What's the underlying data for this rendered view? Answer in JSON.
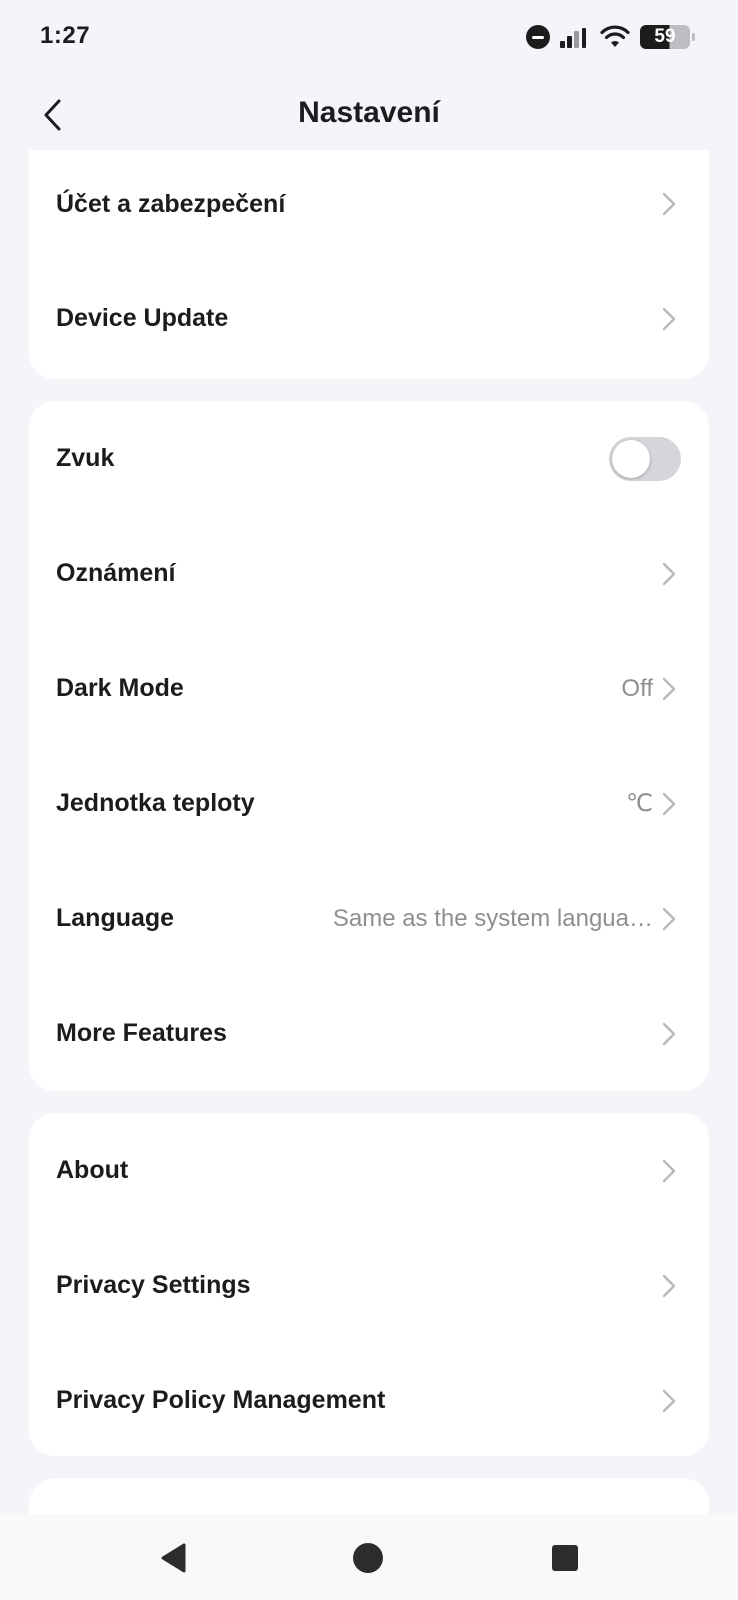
{
  "status_bar": {
    "time": "1:27",
    "battery": "59",
    "icons": [
      "do-not-disturb-icon",
      "signal-icon",
      "wifi-icon",
      "battery-icon"
    ]
  },
  "header": {
    "title": "Nastavení",
    "back_icon": "chevron-left-icon"
  },
  "groups": [
    {
      "items": [
        {
          "label": "Účet a zabezpečení"
        },
        {
          "label": "Device Update"
        }
      ]
    },
    {
      "items": [
        {
          "label": "Zvuk",
          "toggle": false
        },
        {
          "label": "Oznámení"
        },
        {
          "label": "Dark Mode",
          "value": "Off"
        },
        {
          "label": "Jednotka teploty",
          "value": "℃"
        },
        {
          "label": "Language",
          "value": "Same as the system langua…"
        },
        {
          "label": "More Features"
        }
      ]
    },
    {
      "items": [
        {
          "label": "About"
        },
        {
          "label": "Privacy Settings"
        },
        {
          "label": "Privacy Policy Management"
        }
      ]
    }
  ],
  "nav_bar": {
    "buttons": [
      "back-triangle-icon",
      "home-circle-icon",
      "recents-square-icon"
    ]
  },
  "colors": {
    "background": "#f4f5f9",
    "card": "#ffffff",
    "text": "#1c1c1e",
    "secondary_text": "#8e8e93",
    "chevron": "#b8b8bd",
    "toggle_off": "#d6d6da"
  }
}
